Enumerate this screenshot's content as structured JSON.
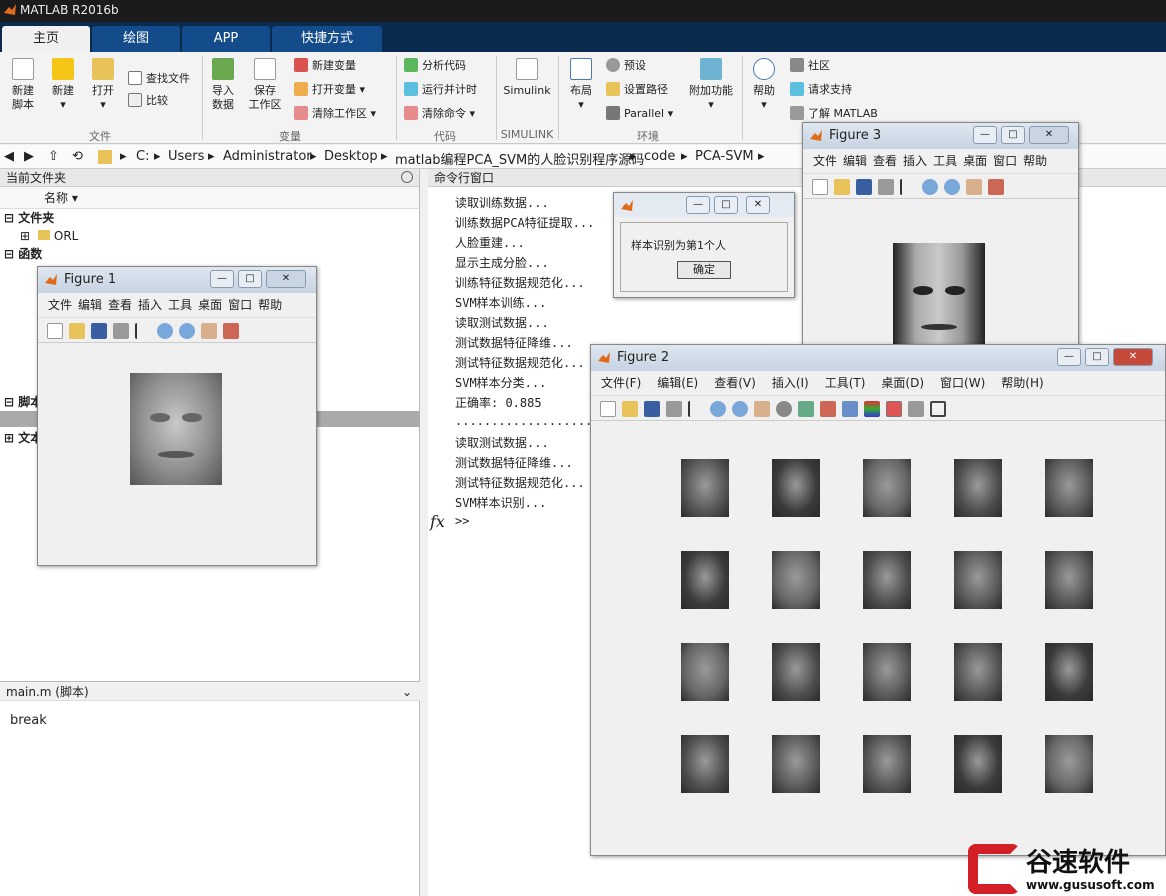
{
  "window": {
    "title": "MATLAB R2016b"
  },
  "tabs": [
    "主页",
    "绘图",
    "APP",
    "快捷方式"
  ],
  "ribbon": {
    "file": {
      "new_script": "新建\n脚本",
      "new": "新建",
      "open": "打开",
      "find_files": "查找文件",
      "compare": "比较",
      "group": "文件"
    },
    "variable": {
      "import": "导入\n数据",
      "save_ws": "保存\n工作区",
      "new_var": "新建变量",
      "open_var": "打开变量",
      "clear_ws": "清除工作区",
      "group": "变量"
    },
    "code": {
      "analyze": "分析代码",
      "run_time": "运行并计时",
      "clear_cmd": "清除命令",
      "group": "代码"
    },
    "simulink": {
      "label": "Simulink",
      "group": "SIMULINK"
    },
    "env": {
      "layout": "布局",
      "prefs": "预设",
      "set_path": "设置路径",
      "parallel": "Parallel",
      "addons": "附加功能",
      "group": "环境"
    },
    "resources": {
      "help": "帮助",
      "community": "社区",
      "support": "请求支持",
      "learn": "了解 MATLAB"
    }
  },
  "address": [
    "C:",
    "Users",
    "Administrator",
    "Desktop",
    "matlab编程PCA_SVM的人脸识别程序源码",
    "code",
    "PCA-SVM"
  ],
  "current_folder": {
    "title": "当前文件夹",
    "col_name": "名称",
    "sec_folder": "文件夹",
    "orl": "ORL",
    "sec_func": "函数",
    "sec_script": "脚本",
    "sec_text": "文本"
  },
  "details": {
    "title": "main.m  (脚本)",
    "content": "break"
  },
  "command_window": {
    "title": "命令行窗口",
    "lines": [
      "读取训练数据...",
      "训练数据PCA特征提取...",
      "人脸重建...",
      "显示主成分脸...",
      "训练特征数据规范化...",
      "SVM样本训练...",
      "读取测试数据...",
      "测试数据特征降维...",
      "测试特征数据规范化...",
      "SVM样本分类...",
      "正确率: 0.885",
      "............................",
      "读取测试数据...",
      "测试数据特征降维...",
      "测试特征数据规范化...",
      "SVM样本识别..."
    ],
    "prompt": ">>",
    "fx": "fx"
  },
  "figure1": {
    "title": "Figure 1",
    "menu": [
      "文件",
      "编辑",
      "查看",
      "插入",
      "工具",
      "桌面",
      "窗口",
      "帮助"
    ]
  },
  "figure2": {
    "title": "Figure 2",
    "menu": [
      "文件(F)",
      "编辑(E)",
      "查看(V)",
      "插入(I)",
      "工具(T)",
      "桌面(D)",
      "窗口(W)",
      "帮助(H)"
    ]
  },
  "figure3": {
    "title": "Figure 3",
    "menu": [
      "文件",
      "编辑",
      "查看",
      "插入",
      "工具",
      "桌面",
      "窗口",
      "帮助"
    ]
  },
  "msgbox": {
    "text": "样本识别为第1个人",
    "ok": "确定"
  },
  "watermark": {
    "brand": "谷速软件",
    "url": "www.gususoft.com"
  },
  "colors": {
    "accent": "#134b8b",
    "title_bg": "#1b1b1b"
  }
}
